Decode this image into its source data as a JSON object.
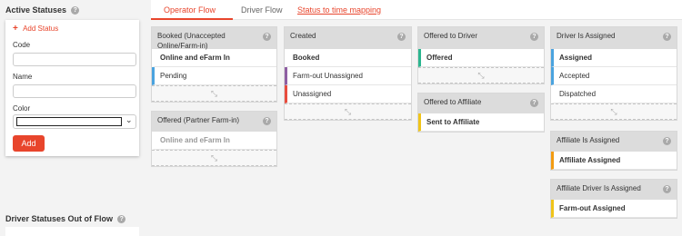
{
  "left": {
    "active_title": "Active Statuses",
    "add_status": "Add Status",
    "code_label": "Code",
    "name_label": "Name",
    "color_label": "Color",
    "add_button": "Add",
    "out_of_flow_title": "Driver Statuses Out of Flow"
  },
  "tabs": [
    "Operator Flow",
    "Driver Flow",
    "Status to time mapping"
  ],
  "columns": {
    "booked": {
      "title": "Booked (Unaccepted Online/Farm-in)",
      "items": [
        "Online and eFarm In",
        "Pending"
      ]
    },
    "offered_partner": {
      "title": "Offered (Partner Farm-in)",
      "items": [
        "Online and eFarm In"
      ]
    },
    "created": {
      "title": "Created",
      "items": [
        "Booked",
        "Farm-out Unassigned",
        "Unassigned"
      ]
    },
    "offered_driver": {
      "title": "Offered to Driver",
      "items": [
        "Offered"
      ]
    },
    "offered_affiliate": {
      "title": "Offered to Affiliate",
      "items": [
        "Sent to Affiliate"
      ]
    },
    "driver_assigned": {
      "title": "Driver Is Assigned",
      "items": [
        "Assigned",
        "Accepted",
        "Dispatched"
      ]
    },
    "affiliate_assigned": {
      "title": "Affiliate Is Assigned",
      "items": [
        "Affiliate Assigned"
      ]
    },
    "affiliate_driver_assigned": {
      "title": "Affiliate Driver Is Assigned",
      "items": [
        "Farm-out Assigned"
      ]
    }
  },
  "help_glyph": "?",
  "drop_glyph": "⤡",
  "colors": {
    "accent": "#e8452c",
    "blue": "#4aa3df",
    "purple": "#8e5ea2",
    "red": "#e84c3d",
    "green": "#2bb58f",
    "yellow": "#f0c419",
    "orange": "#f39c12"
  }
}
